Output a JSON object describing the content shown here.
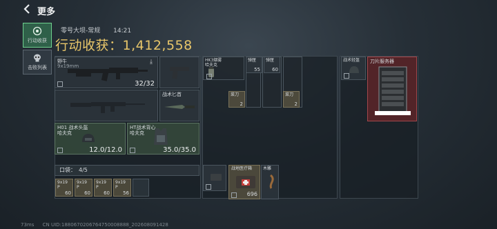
{
  "nav": {
    "title": "更多"
  },
  "side_tabs": [
    {
      "label": "行动收获",
      "icon": "target-icon",
      "active": true
    },
    {
      "label": "击败列表",
      "icon": "skull-icon",
      "active": false
    }
  ],
  "header": {
    "map": "零号大坝-常规",
    "time": "14:21",
    "total_label": "行动收获：",
    "total_value": "1,412,558"
  },
  "gear": {
    "primary_weapon": {
      "name": "野牛",
      "sub": "9x19mm",
      "ammo": "32/32"
    },
    "melee": {
      "name": "战术匕首"
    },
    "helmet": {
      "name": "H01 战术头盔",
      "tag": "哈夫克",
      "durability": "12.0/12.0"
    },
    "armor": {
      "name": "HT战术背心",
      "tag": "哈夫克",
      "durability": "35.0/35.0"
    },
    "pocket": {
      "label": "口袋：",
      "value": "4/5"
    },
    "pocket_items": [
      {
        "name": "9x19",
        "sub": "P",
        "count": "60"
      },
      {
        "name": "9x19",
        "sub": "P",
        "count": "60"
      },
      {
        "name": "9x19",
        "sub": "P",
        "count": "60"
      },
      {
        "name": "9x19",
        "sub": "P",
        "count": "56"
      }
    ]
  },
  "rig": {
    "items": [
      {
        "name": "HK3烟雾",
        "tag": "哈夫克",
        "count": ""
      },
      {
        "name": "弹匣",
        "count": "55"
      },
      {
        "name": "弹匣",
        "count": "60"
      },
      {
        "name": "菜刀",
        "count": "2"
      },
      {
        "name": "菜刀",
        "count": "2"
      }
    ]
  },
  "backpack": {
    "items": [
      {
        "name": "",
        "count": ""
      },
      {
        "name": "战地医疗箱",
        "count": "696"
      },
      {
        "name": "木雕",
        "count": ""
      }
    ]
  },
  "safe": {
    "items": [
      {
        "name": "战术轻盔",
        "tag": ""
      },
      {
        "name": "刀片服务器"
      }
    ]
  },
  "status": {
    "ping": "73ms",
    "uid": "CN UID:1880670206764750008888_202608091428"
  },
  "colors": {
    "accent_gold": "#e8c66a",
    "active_green": "#2f6049",
    "rare_red": "#a3474c"
  }
}
